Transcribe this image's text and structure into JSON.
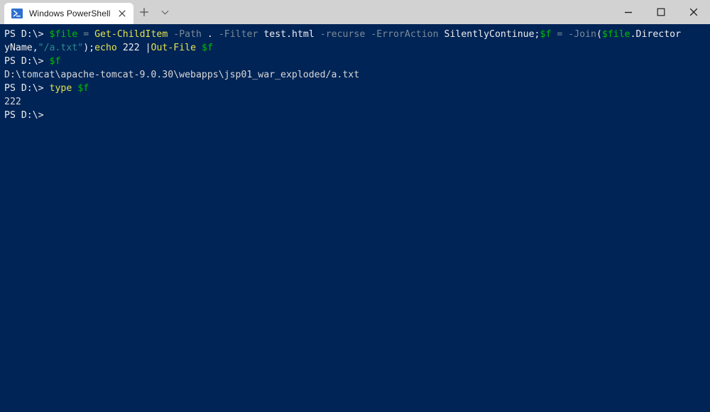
{
  "window": {
    "title": "Windows PowerShell",
    "background_color": "#012456",
    "titlebar_color": "#d2d2d2"
  },
  "titlebar": {
    "tab": {
      "label": "Windows PowerShell",
      "icon": "powershell-icon",
      "close_label": "✕"
    },
    "new_tab_label": "+",
    "tab_menu_label": "⌄",
    "controls": {
      "minimize_label": "─",
      "maximize_label": "□",
      "close_label": "✕"
    }
  },
  "terminal": {
    "prompt": "PS D:\\>",
    "lines": [
      {
        "id": "cmd-line-1a",
        "segments": [
          {
            "text": "PS D:\\> ",
            "token": "white"
          },
          {
            "text": "$file",
            "token": "var"
          },
          {
            "text": " ",
            "token": "default"
          },
          {
            "text": "=",
            "token": "op"
          },
          {
            "text": " ",
            "token": "default"
          },
          {
            "text": "Get-ChildItem",
            "token": "cmdlet"
          },
          {
            "text": " ",
            "token": "default"
          },
          {
            "text": "-Path",
            "token": "param"
          },
          {
            "text": " ",
            "token": "default"
          },
          {
            "text": ".",
            "token": "white"
          },
          {
            "text": " ",
            "token": "default"
          },
          {
            "text": "-Filter",
            "token": "param"
          },
          {
            "text": " ",
            "token": "default"
          },
          {
            "text": "test.html",
            "token": "white"
          },
          {
            "text": " ",
            "token": "default"
          },
          {
            "text": "-recurse",
            "token": "param"
          },
          {
            "text": " ",
            "token": "default"
          },
          {
            "text": "-ErrorAction",
            "token": "param"
          },
          {
            "text": " ",
            "token": "default"
          },
          {
            "text": "SilentlyContinue",
            "token": "white"
          },
          {
            "text": ";",
            "token": "white"
          },
          {
            "text": "$f",
            "token": "var"
          },
          {
            "text": " ",
            "token": "default"
          },
          {
            "text": "=",
            "token": "op"
          },
          {
            "text": " ",
            "token": "default"
          },
          {
            "text": "-Join",
            "token": "op"
          },
          {
            "text": "(",
            "token": "white"
          },
          {
            "text": "$file",
            "token": "var"
          },
          {
            "text": ".Director",
            "token": "white"
          }
        ]
      },
      {
        "id": "cmd-line-1b",
        "segments": [
          {
            "text": "yName",
            "token": "white"
          },
          {
            "text": ",",
            "token": "white"
          },
          {
            "text": "\"/a.txt\"",
            "token": "string"
          },
          {
            "text": ")",
            "token": "white"
          },
          {
            "text": ";",
            "token": "white"
          },
          {
            "text": "echo",
            "token": "cmdlet"
          },
          {
            "text": " ",
            "token": "default"
          },
          {
            "text": "222",
            "token": "white"
          },
          {
            "text": " ",
            "token": "default"
          },
          {
            "text": "|",
            "token": "white"
          },
          {
            "text": "Out-File",
            "token": "cmdlet"
          },
          {
            "text": " ",
            "token": "default"
          },
          {
            "text": "$f",
            "token": "var"
          }
        ]
      },
      {
        "id": "cmd-line-2",
        "segments": [
          {
            "text": "PS D:\\> ",
            "token": "white"
          },
          {
            "text": "$f",
            "token": "var"
          }
        ]
      },
      {
        "id": "output-path",
        "segments": [
          {
            "text": "D:\\tomcat\\apache-tomcat-9.0.30\\webapps\\jsp01_war_exploded/a.txt",
            "token": "output"
          }
        ]
      },
      {
        "id": "cmd-line-3",
        "segments": [
          {
            "text": "PS D:\\> ",
            "token": "white"
          },
          {
            "text": "type",
            "token": "cmdlet"
          },
          {
            "text": " ",
            "token": "default"
          },
          {
            "text": "$f",
            "token": "var"
          }
        ]
      },
      {
        "id": "output-222",
        "segments": [
          {
            "text": "222",
            "token": "output"
          }
        ]
      },
      {
        "id": "cmd-line-4",
        "segments": [
          {
            "text": "PS D:\\>",
            "token": "white"
          }
        ]
      }
    ]
  }
}
